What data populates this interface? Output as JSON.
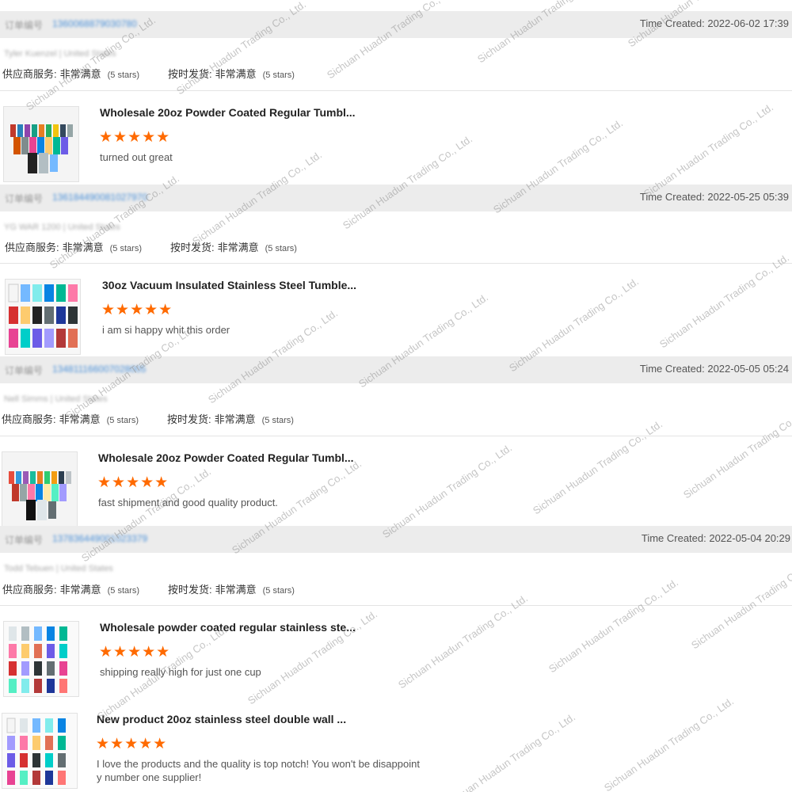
{
  "watermark_text": "Sichuan Huadun Trading Co., Ltd.",
  "star_glyphs": "★★★★★",
  "colors": {
    "accent_orange": "#ff6a00",
    "header_bg": "#ececec",
    "link_blue": "#4a90d9"
  },
  "reviews": [
    {
      "order_label": "订单编号",
      "order_number": "1360068879030780",
      "time_created": "Time Created: 2022-06-02 17:39",
      "buyer": "Tyler Kuenzel | United States",
      "supplier_service_label": "供应商服务:",
      "supplier_service_value": "非常满意",
      "supplier_service_stars": "(5 stars)",
      "on_time_label": "按时发货:",
      "on_time_value": "非常满意",
      "on_time_stars": "(5 stars)",
      "products": [
        {
          "title": "Wholesale 20oz Powder Coated Regular Tumbl...",
          "rating": 5,
          "comment": "turned out great",
          "image_icon": "tumbler-group-photo"
        }
      ]
    },
    {
      "order_label": "订单编号",
      "order_number": "136184490081027970",
      "time_created": "Time Created: 2022-05-25 05:39",
      "buyer": "YG WAR 1200 | United States",
      "supplier_service_label": "供应商服务:",
      "supplier_service_value": "非常满意",
      "supplier_service_stars": "(5 stars)",
      "on_time_label": "按时发货:",
      "on_time_value": "非常满意",
      "on_time_stars": "(5 stars)",
      "products": [
        {
          "title": "30oz Vacuum Insulated Stainless Steel Tumble...",
          "rating": 5,
          "comment": "i am si happy whit this order",
          "image_icon": "tumbler-grid-photo"
        }
      ]
    },
    {
      "order_label": "订单编号",
      "order_number": "134811166007028005",
      "time_created": "Time Created: 2022-05-05 05:24",
      "buyer": "Nell Simms | United States",
      "supplier_service_label": "供应商服务:",
      "supplier_service_value": "非常满意",
      "supplier_service_stars": "(5 stars)",
      "on_time_label": "按时发货:",
      "on_time_value": "非常满意",
      "on_time_stars": "(5 stars)",
      "products": [
        {
          "title": "Wholesale 20oz Powder Coated Regular Tumbl...",
          "rating": 5,
          "comment": "fast shipment and good quality product.",
          "image_icon": "tumbler-group-photo"
        }
      ]
    },
    {
      "order_label": "订单编号",
      "order_number": "137836449001023379",
      "time_created": "Time Created: 2022-05-04 20:29",
      "buyer": "Todd Tebuen | United States",
      "supplier_service_label": "供应商服务:",
      "supplier_service_value": "非常满意",
      "supplier_service_stars": "(5 stars)",
      "on_time_label": "按时发货:",
      "on_time_value": "非常满意",
      "on_time_stars": "(5 stars)",
      "products": [
        {
          "title": "Wholesale powder coated regular stainless ste...",
          "rating": 5,
          "comment": "shipping really high for just one cup",
          "image_icon": "tumbler-grid-photo"
        },
        {
          "title": "New product  20oz stainless steel double wall ...",
          "rating": 5,
          "comment": "I love the products and the quality is top notch! You won't be disappoint y number one supplier!",
          "image_icon": "tumbler-grid-photo"
        }
      ]
    }
  ]
}
